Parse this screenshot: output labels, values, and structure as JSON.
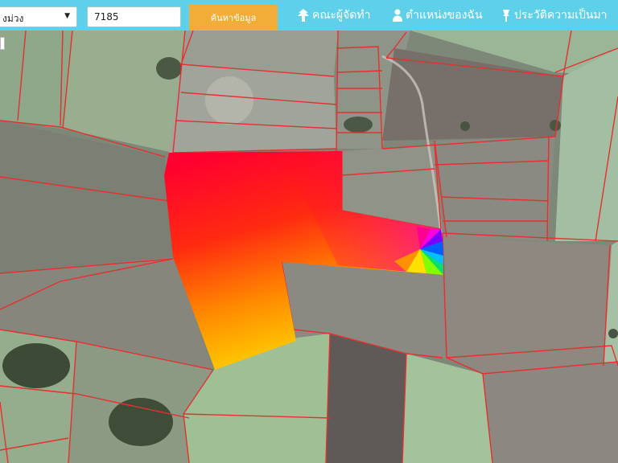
{
  "toolbar": {
    "district_select_value": "งม่วง",
    "parcel_number_value": "7185",
    "search_button_label": "ค้นหาข้อมูล"
  },
  "nav": {
    "team_label": "คณะผู้จัดทำ",
    "my_location_label": "ตำแหน่งของฉัน",
    "history_label": "ประวัติความเป็นมา"
  },
  "icons": {
    "team": "tree-icon",
    "my_location": "person-icon",
    "history": "pin-icon"
  },
  "colors": {
    "topbar": "#5fd0ea",
    "search_button": "#f2ad38",
    "parcel_boundary": "#e53030"
  }
}
